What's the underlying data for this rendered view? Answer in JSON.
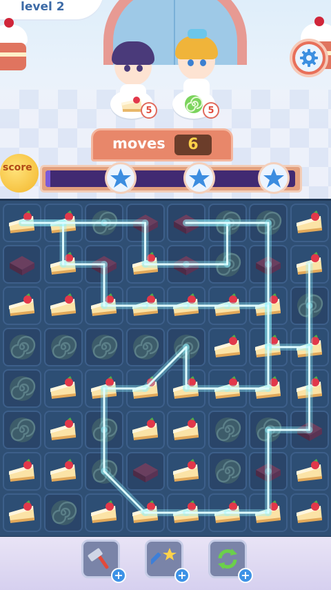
{
  "header": {
    "level_label": "level 2"
  },
  "goals": [
    {
      "icon": "cheesecake-slice-icon",
      "remaining": "5"
    },
    {
      "icon": "green-swiss-roll-icon",
      "remaining": "5"
    }
  ],
  "moves": {
    "label": "moves",
    "value": "6"
  },
  "score": {
    "label": "score",
    "progress": 0.02,
    "star_count": 3
  },
  "board": {
    "rows": 8,
    "cols": 8,
    "legend": {
      "C": "cheesecake-slice-icon",
      "R": "swiss-roll-icon",
      "B": "chocolate-brownie-icon"
    },
    "tiles": [
      [
        "C",
        "C",
        "R",
        "B",
        "B",
        "R",
        "R",
        "C"
      ],
      [
        "B",
        "C",
        "B",
        "C",
        "B",
        "R",
        "B",
        "C"
      ],
      [
        "C",
        "C",
        "C",
        "C",
        "C",
        "C",
        "C",
        "R"
      ],
      [
        "R",
        "R",
        "R",
        "R",
        "R",
        "C",
        "C",
        "C"
      ],
      [
        "R",
        "C",
        "C",
        "C",
        "C",
        "C",
        "C",
        "C"
      ],
      [
        "R",
        "C",
        "R",
        "C",
        "C",
        "R",
        "R",
        "B"
      ],
      [
        "C",
        "C",
        "R",
        "B",
        "C",
        "R",
        "B",
        "C"
      ],
      [
        "C",
        "R",
        "C",
        "C",
        "C",
        "C",
        "C",
        "C"
      ]
    ],
    "selected_path": [
      [
        1,
        7
      ],
      [
        2,
        7
      ],
      [
        3,
        7
      ],
      [
        3,
        6
      ],
      [
        2,
        6
      ],
      [
        2,
        5
      ],
      [
        2,
        4
      ],
      [
        2,
        3
      ],
      [
        2,
        2
      ],
      [
        1,
        2
      ],
      [
        1,
        1
      ],
      [
        0,
        1
      ],
      [
        0,
        0
      ],
      [
        0,
        2
      ],
      [
        0,
        3
      ],
      [
        1,
        3
      ],
      [
        1,
        4
      ],
      [
        1,
        5
      ],
      [
        0,
        5
      ],
      [
        0,
        4
      ],
      [
        0,
        6
      ],
      [
        1,
        6
      ],
      [
        2,
        6
      ],
      [
        3,
        6
      ],
      [
        4,
        6
      ],
      [
        4,
        5
      ],
      [
        4,
        4
      ],
      [
        3,
        4
      ],
      [
        4,
        3
      ],
      [
        4,
        2
      ],
      [
        5,
        2
      ],
      [
        6,
        2
      ],
      [
        7,
        3
      ],
      [
        7,
        4
      ],
      [
        7,
        5
      ],
      [
        7,
        6
      ],
      [
        6,
        6
      ],
      [
        5,
        6
      ],
      [
        5,
        7
      ],
      [
        4,
        7
      ],
      [
        3,
        7
      ]
    ]
  },
  "tools": [
    {
      "name": "hammer-booster",
      "icon": "hammer-icon"
    },
    {
      "name": "magic-wand-booster",
      "icon": "magic-wand-icon"
    },
    {
      "name": "shuffle-booster",
      "icon": "shuffle-icon"
    }
  ],
  "colors": {
    "board": "#2f4f74",
    "link": "#8ff4ff",
    "accent": "#e8876a"
  }
}
